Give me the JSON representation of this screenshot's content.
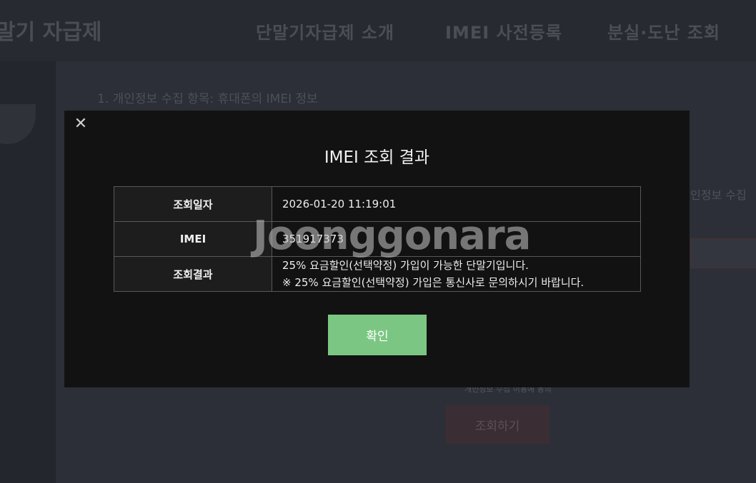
{
  "background": {
    "logo": "말기 자급제",
    "nav": [
      "단말기자급제 소개",
      "IMEI 사전등록",
      "분실·도난 조회"
    ],
    "content_text": "1. 개인정보 수집 항목: 휴대폰의 IMEI 정보",
    "side_text": "인정보 수집",
    "small_text": "개인정보 수집 이용에 동의",
    "search_button": "조회하기"
  },
  "modal": {
    "close_symbol": "✕",
    "title": "IMEI 조회 결과",
    "rows": [
      {
        "label": "조회일자",
        "value": "2026-01-20 11:19:01"
      },
      {
        "label": "IMEI",
        "value": "351917373"
      },
      {
        "label": "조회결과",
        "value_line1": "25% 요금할인(선택약정) 가입이 가능한 단말기입니다.",
        "value_line2": "※ 25% 요금할인(선택약정) 가입은 통신사로 문의하시기 바랍니다."
      }
    ],
    "confirm_label": "확인",
    "watermark": "Joonggonara"
  },
  "colors": {
    "confirm_button": "#7cc683",
    "modal_bg": "#121212",
    "table_border": "#585858"
  }
}
